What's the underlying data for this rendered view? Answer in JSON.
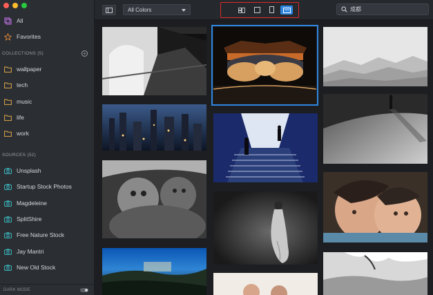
{
  "sidebar": {
    "traffic_colors": [
      "#fc5f57",
      "#fdbc2e",
      "#28c840"
    ],
    "all": "All",
    "favorites": "Favorites",
    "collections_title": "COLLECTIONS (5)",
    "collections": [
      "wallpaper",
      "tech",
      "music",
      "life",
      "work"
    ],
    "sources_title": "SOURCES (52)",
    "sources": [
      "Unsplash",
      "Startup Stock Photos",
      "Magdeleine",
      "SplitShire",
      "Free Nature Stock",
      "Jay Mantri",
      "New Old Stock"
    ],
    "dark_mode_label": "DARK MODE"
  },
  "toolbar": {
    "color_filter": "All Colors",
    "search_value": "成都",
    "view_modes": [
      "masonry",
      "square",
      "portrait",
      "landscape"
    ],
    "active_view": "landscape"
  },
  "colors": {
    "accent": "#2f86e0",
    "highlight": "#e02a2a",
    "folder": "#e0a84a",
    "source_icon": "#3cc0c8",
    "collection_icon": "#b06ad0",
    "favorites_icon": "#e48a3c"
  }
}
